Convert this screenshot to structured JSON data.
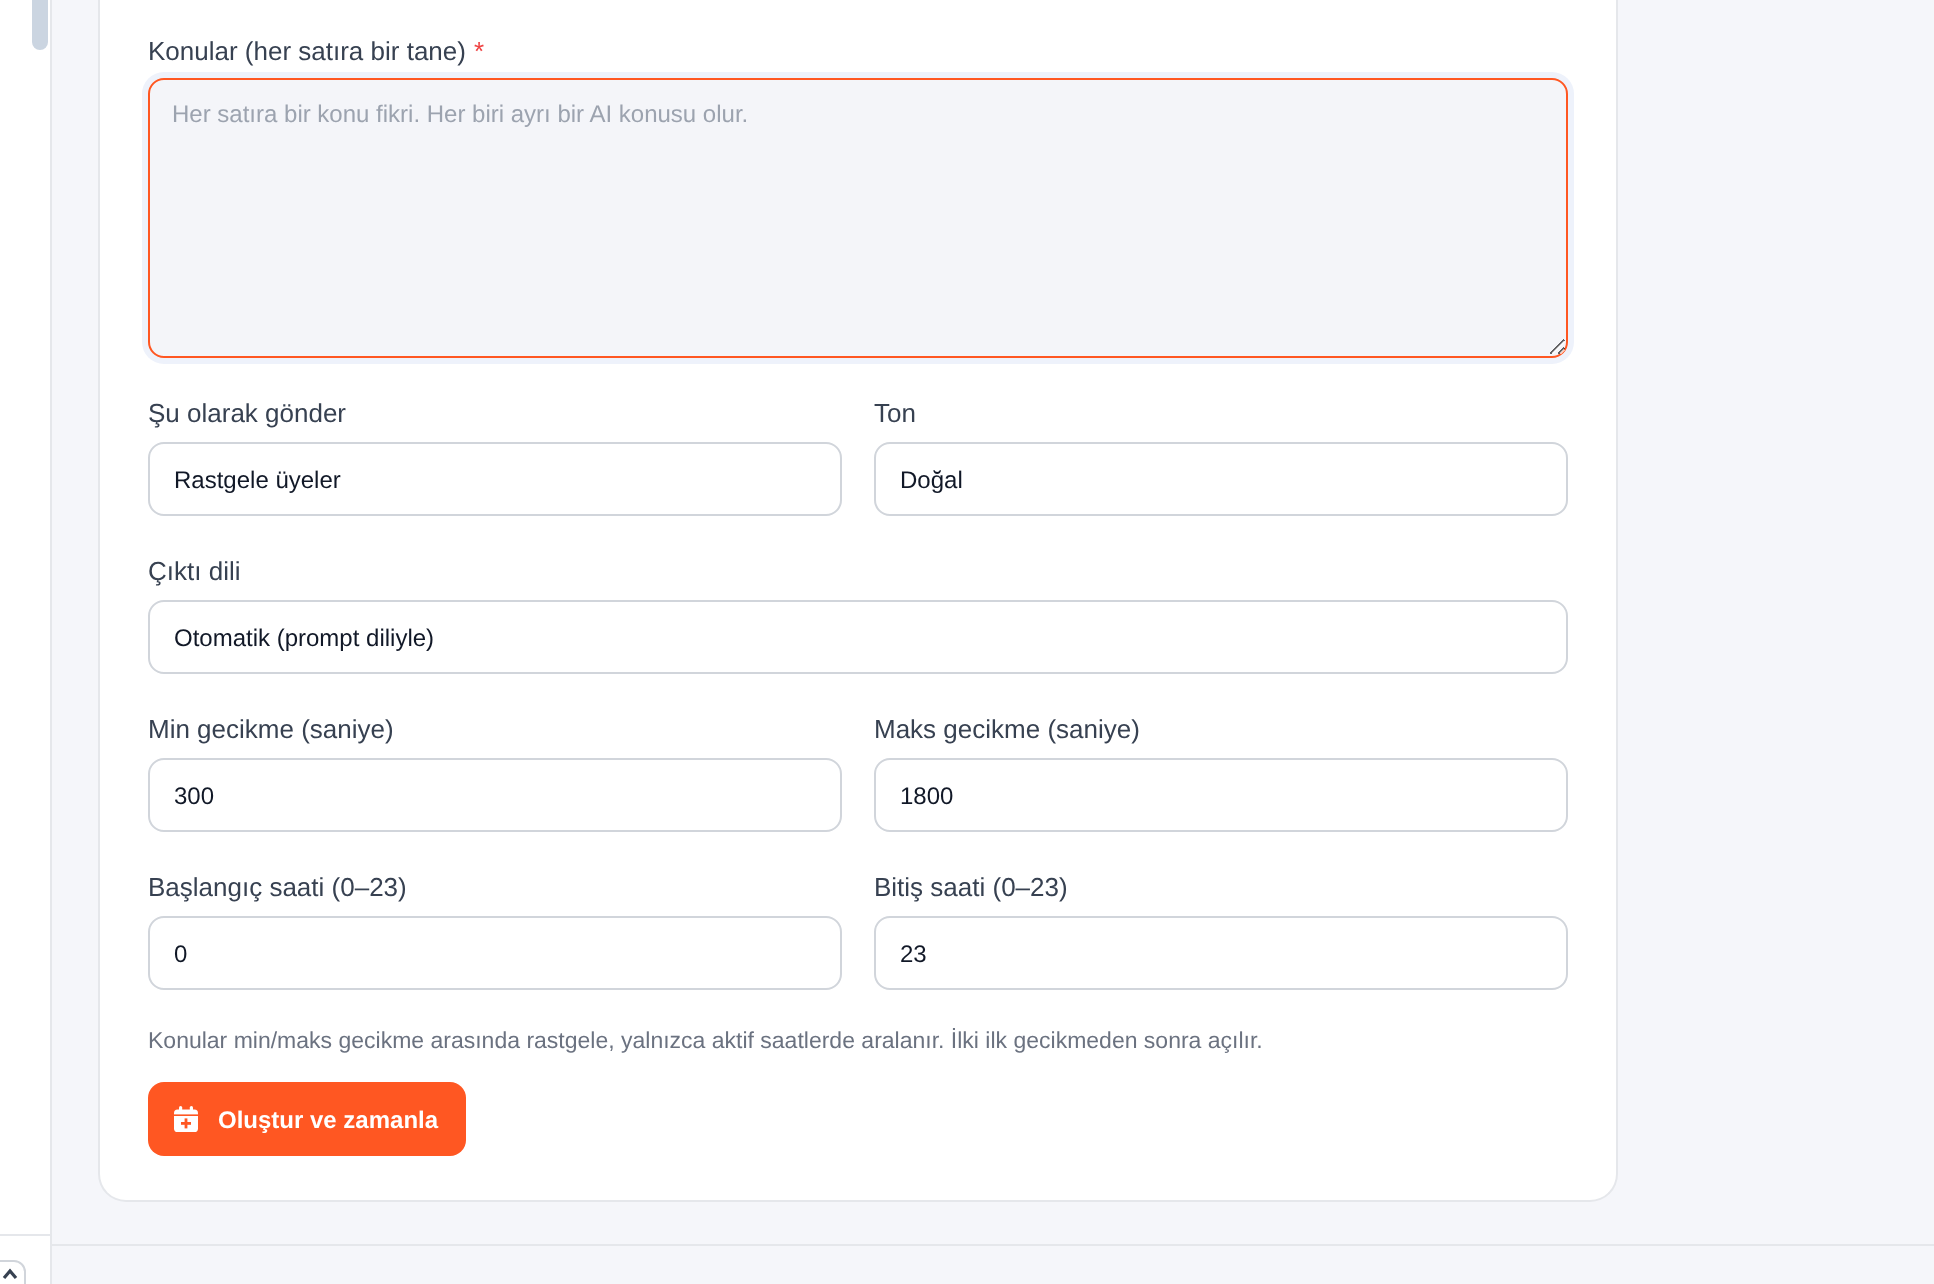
{
  "topics": {
    "label": "Konular (her satıra bir tane)",
    "required_mark": "*",
    "placeholder": "Her satıra bir konu fikri. Her biri ayrı bir AI konusu olur.",
    "focused": true
  },
  "field_rows": [
    {
      "fields": [
        {
          "label": "Şu olarak gönder",
          "value": "Rastgele üyeler"
        },
        {
          "label": "Ton",
          "value": "Doğal"
        }
      ]
    },
    {
      "fields": [
        {
          "label": "Çıktı dili",
          "value": "Otomatik (prompt diliyle)"
        }
      ]
    },
    {
      "fields": [
        {
          "label": "Min gecikme (saniye)",
          "value": "300"
        },
        {
          "label": "Maks gecikme (saniye)",
          "value": "1800"
        }
      ]
    },
    {
      "fields": [
        {
          "label": "Başlangıç saati (0–23)",
          "value": "0"
        },
        {
          "label": "Bitiş saati (0–23)",
          "value": "23"
        }
      ]
    }
  ],
  "hint": "Konular min/maks gecikme arasında rastgele, yalnızca aktif saatlerde aralanır. İlki ilk gecikmeden sonra açılır.",
  "submit_button": {
    "label": "Oluştur ve zamanla"
  }
}
